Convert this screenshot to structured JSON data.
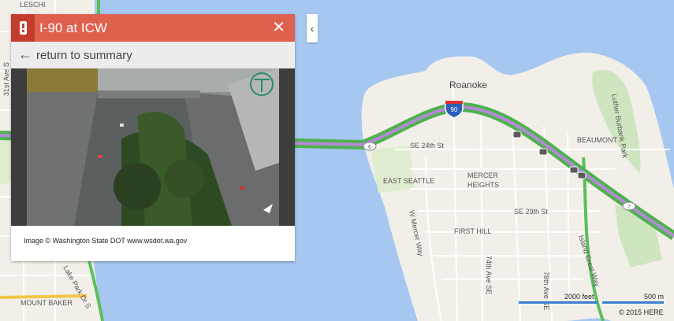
{
  "panel": {
    "title": "I-90 at ICW",
    "close_glyph": "✕",
    "back_label": "return to summary",
    "back_icon": "back-arrow-icon",
    "image_credit": "Image © Washington State DOT www.wsdot.wa.gov",
    "alert_color": "#c43c2c",
    "header_color": "#e0604e"
  },
  "map": {
    "places": {
      "leschi": "LESCHI",
      "ave_31st": "31st Ave S",
      "roanoke": "Roanoke",
      "luther_burbank": "Luther Burbank Park",
      "beaumont": "BEAUMONT",
      "se_24th": "SE 24th St",
      "east_seattle": "EAST SEATTLE",
      "mercer_heights": "MERCER HEIGHTS",
      "se_29th": "SE 29th St",
      "w_mercer_way": "W Mercer Way",
      "first_hill": "FIRST HILL",
      "ave_74th": "74th Ave SE",
      "ave_78th": "78th Ave SE",
      "island_crest": "Island Crest Way",
      "lake_park": "Lake Park Dr S",
      "mount_baker": "MOUNT BAKER"
    },
    "shields": {
      "i90": "90",
      "exit6": "6",
      "exit7": "7"
    },
    "water_color": "#a6c8f0",
    "land_color": "#f2efe9"
  },
  "scale": {
    "feet": "2000 feet",
    "meters": "500 m"
  },
  "copyright": "© 2015 HERE"
}
